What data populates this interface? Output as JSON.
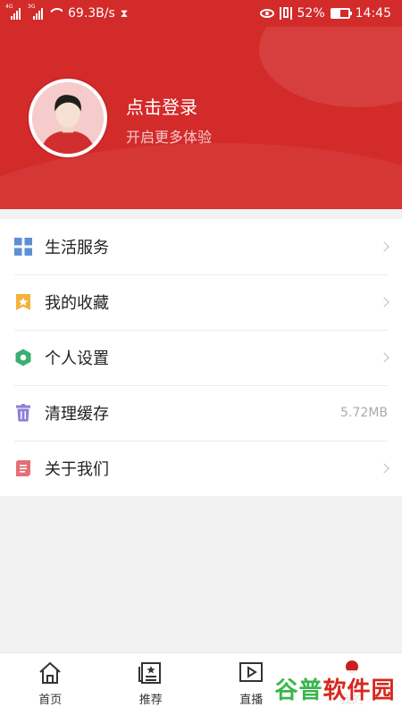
{
  "status_bar": {
    "signal_1_label": "4G",
    "signal_2_label": "3G",
    "speed": "69.3B/s",
    "battery_percent": "52%",
    "battery_level": 0.52,
    "time": "14:45"
  },
  "header": {
    "login_title": "点击登录",
    "login_subtitle": "开启更多体验"
  },
  "menu": {
    "items": [
      {
        "label": "生活服务",
        "icon": "grid-icon",
        "color": "#5b8fd6"
      },
      {
        "label": "我的收藏",
        "icon": "bookmark-star-icon",
        "color": "#f2b33c"
      },
      {
        "label": "个人设置",
        "icon": "hexagon-settings-icon",
        "color": "#3aaf74"
      },
      {
        "label": "清理缓存",
        "icon": "trash-icon",
        "color": "#8a7fd8",
        "value": "5.72MB"
      },
      {
        "label": "关于我们",
        "icon": "document-icon",
        "color": "#e56f78"
      }
    ]
  },
  "bottom_nav": {
    "tabs": [
      {
        "label": "首页",
        "icon": "home-icon"
      },
      {
        "label": "推荐",
        "icon": "news-icon"
      },
      {
        "label": "直播",
        "icon": "play-icon"
      },
      {
        "label": "我的",
        "icon": "profile-icon"
      }
    ]
  },
  "watermark": {
    "part1": "谷普",
    "part2": "软件园"
  },
  "colors": {
    "brand_red": "#d32a2a",
    "background": "#f2f2f2"
  }
}
